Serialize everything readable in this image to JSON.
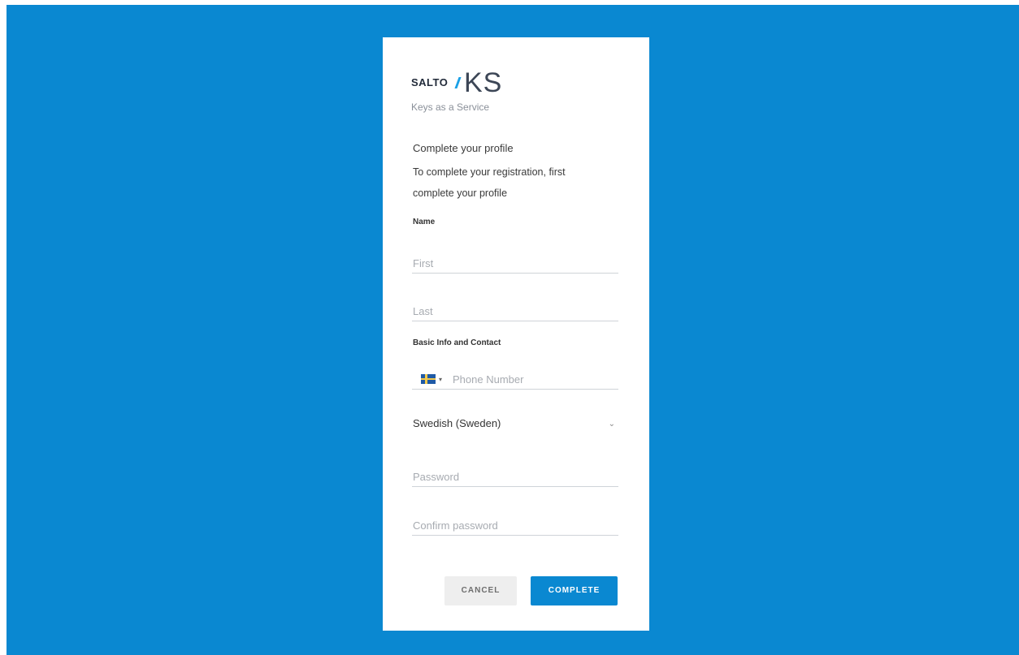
{
  "brand": {
    "name_left": "SALTO",
    "name_right": "KS",
    "tagline": "Keys as a Service"
  },
  "form": {
    "title": "Complete your profile",
    "subtitle": "To complete your registration, first complete your profile",
    "sections": {
      "name_label": "Name",
      "contact_label": "Basic Info and Contact"
    },
    "fields": {
      "first": {
        "placeholder": "First",
        "value": ""
      },
      "last": {
        "placeholder": "Last",
        "value": ""
      },
      "phone": {
        "placeholder": "Phone Number",
        "country": "Sweden",
        "flag_icon": "sweden-flag-icon"
      },
      "language": {
        "value": "Swedish (Sweden)"
      },
      "password": {
        "placeholder": "Password",
        "value": ""
      },
      "confirm_password": {
        "placeholder": "Confirm password",
        "value": ""
      }
    },
    "buttons": {
      "cancel": "CANCEL",
      "complete": "COMPLETE"
    }
  },
  "colors": {
    "background": "#0a88d1",
    "primary_button": "#0a88d1",
    "secondary_button": "#eeeeee",
    "logo_accent": "#1aa0e6"
  }
}
